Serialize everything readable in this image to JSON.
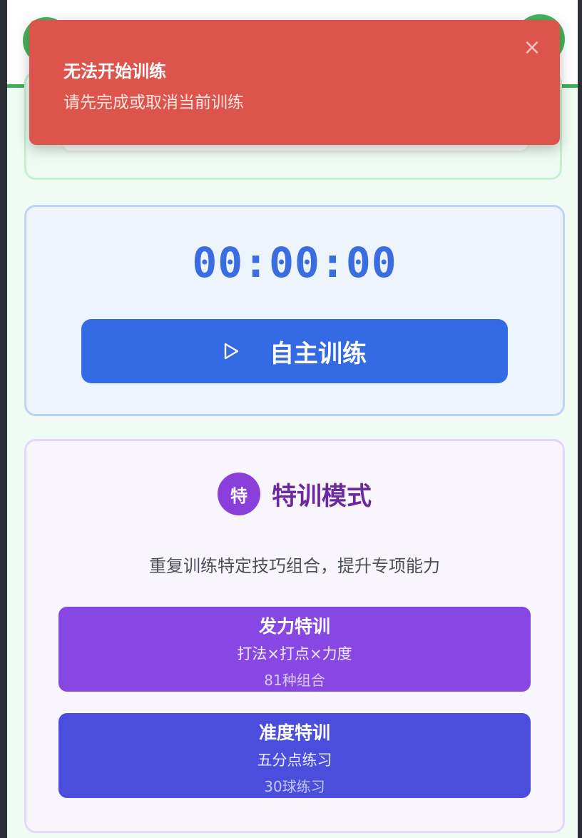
{
  "toast": {
    "title": "无法开始训练",
    "message": "请先完成或取消当前训练",
    "close_icon": "×"
  },
  "timer": {
    "display": "00:00:00",
    "start_button_label": "自主训练"
  },
  "special_mode": {
    "badge": "特",
    "title": "特训模式",
    "description": "重复训练特定技巧组合，提升专项能力",
    "modes": [
      {
        "title": "发力特训",
        "subtitle": "打法×打点×力度",
        "count": "81种组合",
        "color": "#8747e2"
      },
      {
        "title": "准度特训",
        "subtitle": "五分点练习",
        "count": "30球练习",
        "color": "#4b4ddc"
      }
    ]
  },
  "colors": {
    "toast_bg": "#dc544b",
    "primary_blue": "#356ae5",
    "purple": "#8a3fdb",
    "green_accent": "#3fae55"
  }
}
